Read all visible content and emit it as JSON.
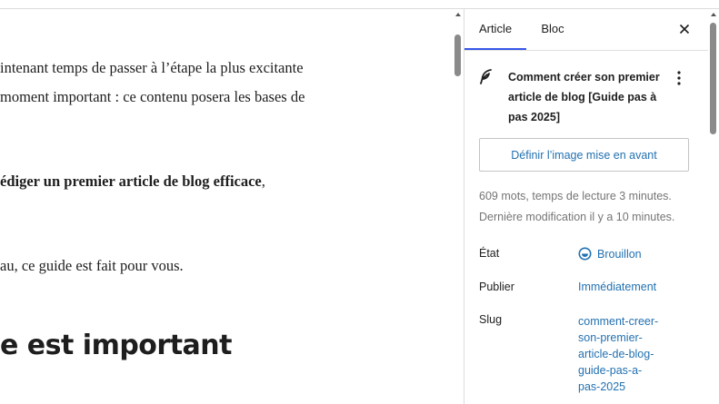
{
  "editor": {
    "line1": "intenant temps de passer à l’étape la plus excitante",
    "line2": "moment important : ce contenu posera les bases de",
    "line3_bold": "édiger un premier article de blog efficace",
    "line3_rest": ",",
    "line4": "au, ce guide est fait pour vous.",
    "heading": "e est important"
  },
  "sidebar": {
    "tabs": [
      {
        "label": "Article"
      },
      {
        "label": "Bloc"
      }
    ],
    "post_title": "Comment créer son premier article de blog [Guide pas à pas 2025]",
    "featured_image_button": "Définir l’image mise en avant",
    "word_count": "609 mots, temps de lecture 3 minutes.",
    "last_modified": "Dernière modification il y a 10 minutes.",
    "rows": {
      "etat": {
        "label": "État",
        "value": "Brouillon"
      },
      "publier": {
        "label": "Publier",
        "value": "Immédiatement"
      },
      "slug": {
        "label": "Slug",
        "value": "comment-creer-son-premier-article-de-blog-guide-pas-a-pas-2025"
      }
    }
  },
  "colors": {
    "accent": "#3858e9",
    "link": "#2271b1",
    "muted": "#757575"
  },
  "icons": {
    "close": "close-icon",
    "post": "feather-icon",
    "more": "kebab-icon",
    "status": "draft-status-icon"
  }
}
